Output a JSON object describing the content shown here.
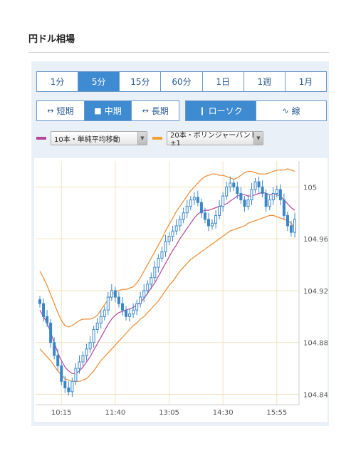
{
  "page_title": "円ドル相場",
  "periods": [
    {
      "label": "1分",
      "active": false
    },
    {
      "label": "5分",
      "active": true
    },
    {
      "label": "15分",
      "active": false
    },
    {
      "label": "60分",
      "active": false
    },
    {
      "label": "1日",
      "active": false
    },
    {
      "label": "1週",
      "active": false
    },
    {
      "label": "1月",
      "active": false
    }
  ],
  "term_buttons": [
    {
      "label": "短期",
      "icon": "short-term-icon",
      "active": false
    },
    {
      "label": "中期",
      "icon": "mid-term-icon",
      "active": true
    },
    {
      "label": "長期",
      "icon": "long-term-icon",
      "active": false
    }
  ],
  "style_buttons": [
    {
      "label": "ローソク",
      "icon": "candlestick-icon",
      "active": true
    },
    {
      "label": "線",
      "icon": "line-chart-icon",
      "active": false
    }
  ],
  "indicators": [
    {
      "label": "10本・単純平均移動",
      "color": "#b5459b"
    },
    {
      "label": "20本・ボリンジャーバンド±1",
      "color": "#f0a030"
    }
  ],
  "colors": {
    "candle": "#3a86c8",
    "ma": "#b5459b",
    "band": "#f08a30",
    "grid": "#f3e3c0",
    "active": "#3f8bd1"
  },
  "chart_data": {
    "type": "candlestick",
    "y_ticks": [
      "105",
      "104.96",
      "104.92",
      "104.88",
      "104.84"
    ],
    "x_ticks": [
      "10:15",
      "11:40",
      "13:05",
      "14:30",
      "15:55"
    ],
    "ylim": [
      104.832,
      105.02
    ],
    "grid": true,
    "close": [
      104.91,
      104.9,
      104.895,
      104.88,
      104.87,
      104.862,
      104.85,
      104.845,
      104.842,
      104.85,
      104.86,
      104.865,
      104.87,
      104.875,
      104.88,
      104.89,
      104.895,
      104.9,
      104.905,
      104.915,
      104.92,
      104.915,
      104.91,
      104.905,
      104.9,
      104.902,
      104.905,
      104.91,
      104.915,
      104.92,
      104.925,
      104.93,
      104.938,
      104.945,
      104.95,
      104.958,
      104.962,
      104.966,
      104.97,
      104.975,
      104.98,
      104.985,
      104.99,
      104.992,
      104.988,
      104.98,
      104.975,
      104.97,
      104.972,
      104.978,
      104.985,
      104.993,
      105.0,
      105.003,
      105.0,
      104.995,
      104.99,
      104.985,
      104.99,
      104.998,
      105.004,
      105.0,
      104.995,
      104.985,
      104.99,
      104.995,
      104.998,
      104.99,
      104.978,
      104.97,
      104.965,
      104.975
    ],
    "ma10": [
      104.905,
      104.9,
      104.895,
      104.888,
      104.88,
      104.872,
      104.866,
      104.861,
      104.858,
      104.856,
      104.856,
      104.858,
      104.861,
      104.865,
      104.869,
      104.874,
      104.879,
      104.884,
      104.889,
      104.894,
      104.898,
      104.901,
      104.903,
      104.904,
      104.905,
      104.906,
      104.907,
      104.909,
      104.911,
      104.914,
      104.918,
      104.922,
      104.926,
      104.931,
      104.936,
      104.941,
      104.946,
      104.951,
      104.955,
      104.96,
      104.964,
      104.968,
      104.972,
      104.976,
      104.979,
      104.981,
      104.982,
      104.982,
      104.983,
      104.984,
      104.985,
      104.986,
      104.987,
      104.989,
      104.991,
      104.993,
      104.994,
      104.994,
      104.993,
      104.993,
      104.994,
      104.995,
      104.996,
      104.995,
      104.994,
      104.994,
      104.994,
      104.993,
      104.99,
      104.987,
      104.984,
      104.982
    ],
    "band_upper": [
      104.935,
      104.93,
      104.924,
      104.917,
      104.91,
      104.903,
      104.897,
      104.893,
      104.892,
      104.893,
      104.895,
      104.897,
      104.898,
      104.898,
      104.898,
      104.899,
      104.901,
      104.905,
      104.909,
      104.913,
      104.917,
      104.919,
      104.92,
      104.921,
      104.921,
      104.922,
      104.923,
      104.926,
      104.93,
      104.935,
      104.94,
      104.945,
      104.95,
      104.955,
      104.96,
      104.966,
      104.971,
      104.976,
      104.981,
      104.985,
      104.989,
      104.993,
      104.997,
      105.0,
      105.003,
      105.006,
      105.008,
      105.009,
      105.01,
      105.01,
      105.009,
      105.009,
      105.008,
      105.007,
      105.006,
      105.007,
      105.009,
      105.011,
      105.012,
      105.012,
      105.011,
      105.01,
      105.01,
      105.01,
      105.011,
      105.012,
      105.013,
      105.013,
      105.013,
      105.014,
      105.013,
      105.012
    ],
    "band_lower": [
      104.875,
      104.872,
      104.869,
      104.866,
      104.862,
      104.858,
      104.855,
      104.852,
      104.851,
      104.85,
      104.85,
      104.85,
      104.851,
      104.852,
      104.855,
      104.858,
      104.862,
      104.866,
      104.869,
      104.872,
      104.875,
      104.878,
      104.881,
      104.884,
      104.887,
      104.89,
      104.893,
      104.895,
      104.898,
      104.9,
      104.903,
      104.906,
      104.909,
      104.912,
      104.916,
      104.92,
      104.924,
      104.927,
      104.931,
      104.935,
      104.938,
      104.941,
      104.944,
      104.946,
      104.948,
      104.95,
      104.952,
      104.954,
      104.956,
      104.958,
      104.96,
      104.962,
      104.964,
      104.966,
      104.967,
      104.968,
      104.969,
      104.97,
      104.972,
      104.973,
      104.974,
      104.975,
      104.976,
      104.977,
      104.978,
      104.978,
      104.977,
      104.976,
      104.975,
      104.974,
      104.972,
      104.968
    ]
  }
}
